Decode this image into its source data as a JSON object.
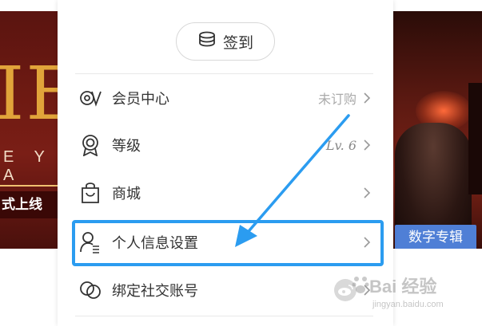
{
  "left_banner": {
    "big_text": "IE",
    "sub_text": "E Y A",
    "launch_text": "式上线"
  },
  "right_banner": {
    "tag": "数字专辑"
  },
  "signin": {
    "label": "签到",
    "icon": "coin-stack-icon"
  },
  "menu": {
    "items": [
      {
        "label": "会员中心",
        "value": "未订购",
        "icon": "vip-icon"
      },
      {
        "label": "等级",
        "value": "Lv. 6",
        "icon": "medal-icon"
      },
      {
        "label": "商城",
        "value": "",
        "icon": "shopping-bag-icon"
      },
      {
        "label": "个人信息设置",
        "value": "",
        "icon": "user-profile-icon"
      },
      {
        "label": "绑定社交账号",
        "value": "",
        "icon": "link-icon",
        "badge_icon": "weibo-icon"
      }
    ]
  },
  "annotation": {
    "highlight_color": "#2b9cf0",
    "arrow_color": "#2b9cf0"
  },
  "watermark": {
    "main": "Bai 经验",
    "sub": "jingyan.baidu.com"
  }
}
